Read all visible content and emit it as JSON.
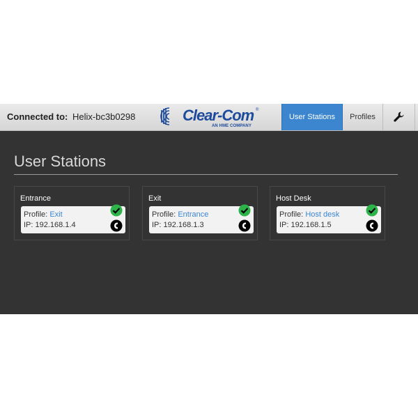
{
  "header": {
    "connected_label": "Connected to:",
    "device_name": "Helix-bc3b0298",
    "logo": {
      "brand": "Clear-Com",
      "registered": "®",
      "tagline": "AN HME COMPANY"
    },
    "tabs": [
      {
        "label": "User Stations",
        "active": true
      },
      {
        "label": "Profiles",
        "active": false
      },
      {
        "icon": "wrench-icon",
        "active": false
      }
    ]
  },
  "page": {
    "title": "User Stations"
  },
  "stations": [
    {
      "name": "Entrance",
      "profile_label": "Profile:",
      "profile": "Exit",
      "ip_label": "IP:",
      "ip": "192.168.1.4"
    },
    {
      "name": "Exit",
      "profile_label": "Profile:",
      "profile": "Entrance",
      "ip_label": "IP:",
      "ip": "192.168.1.3"
    },
    {
      "name": "Host Desk",
      "profile_label": "Profile:",
      "profile": "Host desk",
      "ip_label": "IP:",
      "ip": "192.168.1.5"
    }
  ],
  "colors": {
    "accent": "#3b86cf",
    "background": "#333333",
    "status_ok": "#2db34a",
    "brand": "#1d4a9b"
  },
  "icons": {
    "status": "check-circle-icon",
    "call": "phone-handset-icon"
  }
}
